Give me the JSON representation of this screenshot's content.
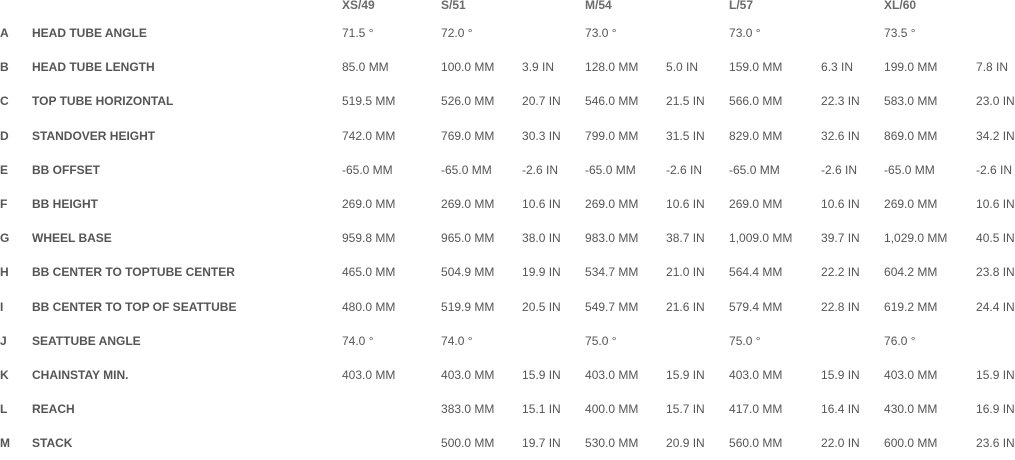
{
  "sizes": [
    "XS/49",
    "S/51",
    "M/54",
    "L/57",
    "XL/60"
  ],
  "rows": [
    {
      "letter": "A",
      "label": "HEAD TUBE ANGLE",
      "cells": [
        "71.5 °",
        "",
        "72.0 °",
        "",
        "73.0 °",
        "",
        "73.0 °",
        "",
        "73.5 °",
        ""
      ]
    },
    {
      "letter": "B",
      "label": "HEAD TUBE LENGTH",
      "cells": [
        "85.0 MM",
        "",
        "100.0 MM",
        "3.9 IN",
        "128.0 MM",
        "5.0 IN",
        "159.0 MM",
        "6.3 IN",
        "199.0 MM",
        "7.8 IN"
      ]
    },
    {
      "letter": "C",
      "label": "TOP TUBE HORIZONTAL",
      "cells": [
        "519.5 MM",
        "",
        "526.0 MM",
        "20.7 IN",
        "546.0 MM",
        "21.5 IN",
        "566.0 MM",
        "22.3 IN",
        "583.0 MM",
        "23.0 IN"
      ]
    },
    {
      "letter": "D",
      "label": "STANDOVER HEIGHT",
      "cells": [
        "742.0 MM",
        "",
        "769.0 MM",
        "30.3 IN",
        "799.0 MM",
        "31.5 IN",
        "829.0 MM",
        "32.6 IN",
        "869.0 MM",
        "34.2 IN"
      ]
    },
    {
      "letter": "E",
      "label": "BB OFFSET",
      "cells": [
        "-65.0 MM",
        "",
        "-65.0 MM",
        "-2.6 IN",
        "-65.0 MM",
        "-2.6 IN",
        "-65.0 MM",
        "-2.6 IN",
        "-65.0 MM",
        "-2.6 IN"
      ]
    },
    {
      "letter": "F",
      "label": "BB HEIGHT",
      "cells": [
        "269.0 MM",
        "",
        "269.0 MM",
        "10.6 IN",
        "269.0 MM",
        "10.6 IN",
        "269.0 MM",
        "10.6 IN",
        "269.0 MM",
        "10.6 IN"
      ]
    },
    {
      "letter": "G",
      "label": "WHEEL BASE",
      "cells": [
        "959.8 MM",
        "",
        "965.0 MM",
        "38.0 IN",
        "983.0 MM",
        "38.7 IN",
        "1,009.0 MM",
        "39.7 IN",
        "1,029.0 MM",
        "40.5 IN"
      ]
    },
    {
      "letter": "H",
      "label": "BB CENTER TO TOPTUBE CENTER",
      "cells": [
        "465.0 MM",
        "",
        "504.9 MM",
        "19.9 IN",
        "534.7 MM",
        "21.0 IN",
        "564.4 MM",
        "22.2 IN",
        "604.2 MM",
        "23.8 IN"
      ]
    },
    {
      "letter": "I",
      "label": "BB CENTER TO TOP OF SEATTUBE",
      "cells": [
        "480.0 MM",
        "",
        "519.9 MM",
        "20.5 IN",
        "549.7 MM",
        "21.6 IN",
        "579.4 MM",
        "22.8 IN",
        "619.2 MM",
        "24.4 IN"
      ]
    },
    {
      "letter": "J",
      "label": "SEATTUBE ANGLE",
      "cells": [
        "74.0 °",
        "",
        "74.0 °",
        "",
        "75.0 °",
        "",
        "75.0 °",
        "",
        "76.0 °",
        ""
      ]
    },
    {
      "letter": "K",
      "label": "CHAINSTAY MIN.",
      "cells": [
        "403.0 MM",
        "",
        "403.0 MM",
        "15.9 IN",
        "403.0 MM",
        "15.9 IN",
        "403.0 MM",
        "15.9 IN",
        "403.0 MM",
        "15.9 IN"
      ]
    },
    {
      "letter": "L",
      "label": "REACH",
      "cells": [
        "",
        "",
        "383.0 MM",
        "15.1 IN",
        "400.0 MM",
        "15.7 IN",
        "417.0 MM",
        "16.4 IN",
        "430.0 MM",
        "16.9 IN"
      ]
    },
    {
      "letter": "M",
      "label": "STACK",
      "cells": [
        "",
        "",
        "500.0 MM",
        "19.7 IN",
        "530.0 MM",
        "20.9 IN",
        "560.0 MM",
        "22.0 IN",
        "600.0 MM",
        "23.6 IN"
      ]
    }
  ],
  "colors": {
    "text": "#555555",
    "header": "#6a6a6a",
    "background": "#ffffff"
  }
}
